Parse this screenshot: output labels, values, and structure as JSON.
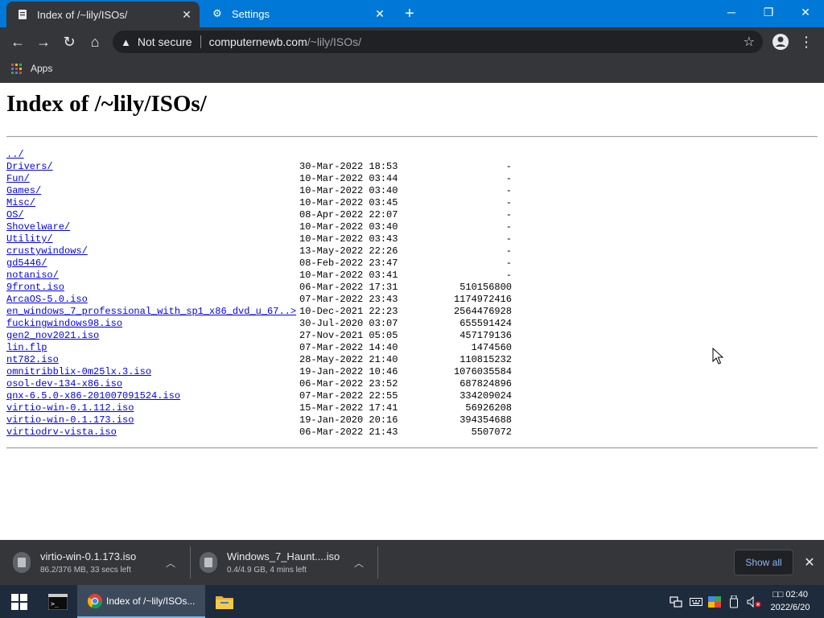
{
  "browser": {
    "tabs": [
      {
        "title": "Index of /~lily/ISOs/",
        "icon": "page-icon",
        "active": true
      },
      {
        "title": "Settings",
        "icon": "gear-icon",
        "active": false
      }
    ],
    "security_label": "Not secure",
    "url_host": "computernewb.com",
    "url_path": "/~lily/ISOs/",
    "bookmark_apps_label": "Apps"
  },
  "page": {
    "heading": "Index of /~lily/ISOs/",
    "entries": [
      {
        "name": "../",
        "date": "",
        "size": ""
      },
      {
        "name": "Drivers/",
        "date": "30-Mar-2022 18:53",
        "size": "-"
      },
      {
        "name": "Fun/",
        "date": "10-Mar-2022 03:44",
        "size": "-"
      },
      {
        "name": "Games/",
        "date": "10-Mar-2022 03:40",
        "size": "-"
      },
      {
        "name": "Misc/",
        "date": "10-Mar-2022 03:45",
        "size": "-"
      },
      {
        "name": "OS/",
        "date": "08-Apr-2022 22:07",
        "size": "-"
      },
      {
        "name": "Shovelware/",
        "date": "10-Mar-2022 03:40",
        "size": "-"
      },
      {
        "name": "Utility/",
        "date": "10-Mar-2022 03:43",
        "size": "-"
      },
      {
        "name": "crustywindows/",
        "date": "13-May-2022 22:26",
        "size": "-"
      },
      {
        "name": "gd5446/",
        "date": "08-Feb-2022 23:47",
        "size": "-"
      },
      {
        "name": "notaniso/",
        "date": "10-Mar-2022 03:41",
        "size": "-"
      },
      {
        "name": "9front.iso",
        "date": "06-Mar-2022 17:31",
        "size": "510156800"
      },
      {
        "name": "ArcaOS-5.0.iso",
        "date": "07-Mar-2022 23:43",
        "size": "1174972416"
      },
      {
        "name": "en_windows_7_professional_with_sp1_x86_dvd_u_67..>",
        "date": "10-Dec-2021 22:23",
        "size": "2564476928"
      },
      {
        "name": "fuckingwindows98.iso",
        "date": "30-Jul-2020 03:07",
        "size": "655591424"
      },
      {
        "name": "gen2_nov2021.iso",
        "date": "27-Nov-2021 05:05",
        "size": "457179136"
      },
      {
        "name": "lin.flp",
        "date": "07-Mar-2022 14:40",
        "size": "1474560"
      },
      {
        "name": "nt782.iso",
        "date": "28-May-2022 21:40",
        "size": "110815232"
      },
      {
        "name": "omnitribblix-0m25lx.3.iso",
        "date": "19-Jan-2022 10:46",
        "size": "1076035584"
      },
      {
        "name": "osol-dev-134-x86.iso",
        "date": "06-Mar-2022 23:52",
        "size": "687824896"
      },
      {
        "name": "qnx-6.5.0-x86-201007091524.iso",
        "date": "07-Mar-2022 22:55",
        "size": "334209024"
      },
      {
        "name": "virtio-win-0.1.112.iso",
        "date": "15-Mar-2022 17:41",
        "size": "56926208"
      },
      {
        "name": "virtio-win-0.1.173.iso",
        "date": "19-Jan-2020 20:16",
        "size": "394354688"
      },
      {
        "name": "virtiodrv-vista.iso",
        "date": "06-Mar-2022 21:43",
        "size": "5507072"
      }
    ]
  },
  "downloads": {
    "items": [
      {
        "filename": "virtio-win-0.1.173.iso",
        "status": "86.2/376 MB, 33 secs left"
      },
      {
        "filename": "Windows_7_Haunt....iso",
        "status": "0.4/4.9 GB, 4 mins left"
      }
    ],
    "show_all_label": "Show all"
  },
  "taskbar": {
    "chrome_window_title": "Index of /~lily/ISOs...",
    "clock_time": "□□ 02:40",
    "clock_date": "2022/6/20"
  },
  "colors": {
    "title_bar": "#0078d7",
    "browser_chrome": "#35363a",
    "link": "#0000ee",
    "taskbar": "#1e2b3c"
  }
}
